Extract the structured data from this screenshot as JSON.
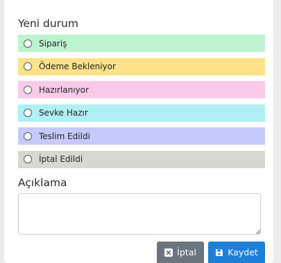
{
  "status_section": {
    "title": "Yeni durum",
    "options": [
      {
        "label": "Sipariş",
        "color": "#bdf3ce",
        "selected": false
      },
      {
        "label": "Ödeme Bekleniyor",
        "color": "#fde28a",
        "selected": false
      },
      {
        "label": "Hazırlanıyor",
        "color": "#f8c9e8",
        "selected": false
      },
      {
        "label": "Sevke Hazır",
        "color": "#b0eff3",
        "selected": false
      },
      {
        "label": "Teslim Edildi",
        "color": "#c5c9fb",
        "selected": false
      },
      {
        "label": "İptal Edildi",
        "color": "#d8d7d3",
        "selected": false
      }
    ]
  },
  "description": {
    "title": "Açıklama",
    "value": "",
    "placeholder": ""
  },
  "actions": {
    "cancel_label": "İptal",
    "cancel_icon": "close-box-icon",
    "cancel_color": "#6c757d",
    "save_label": "Kaydet",
    "save_icon": "floppy-disk-icon",
    "save_color": "#1e7fd6"
  }
}
